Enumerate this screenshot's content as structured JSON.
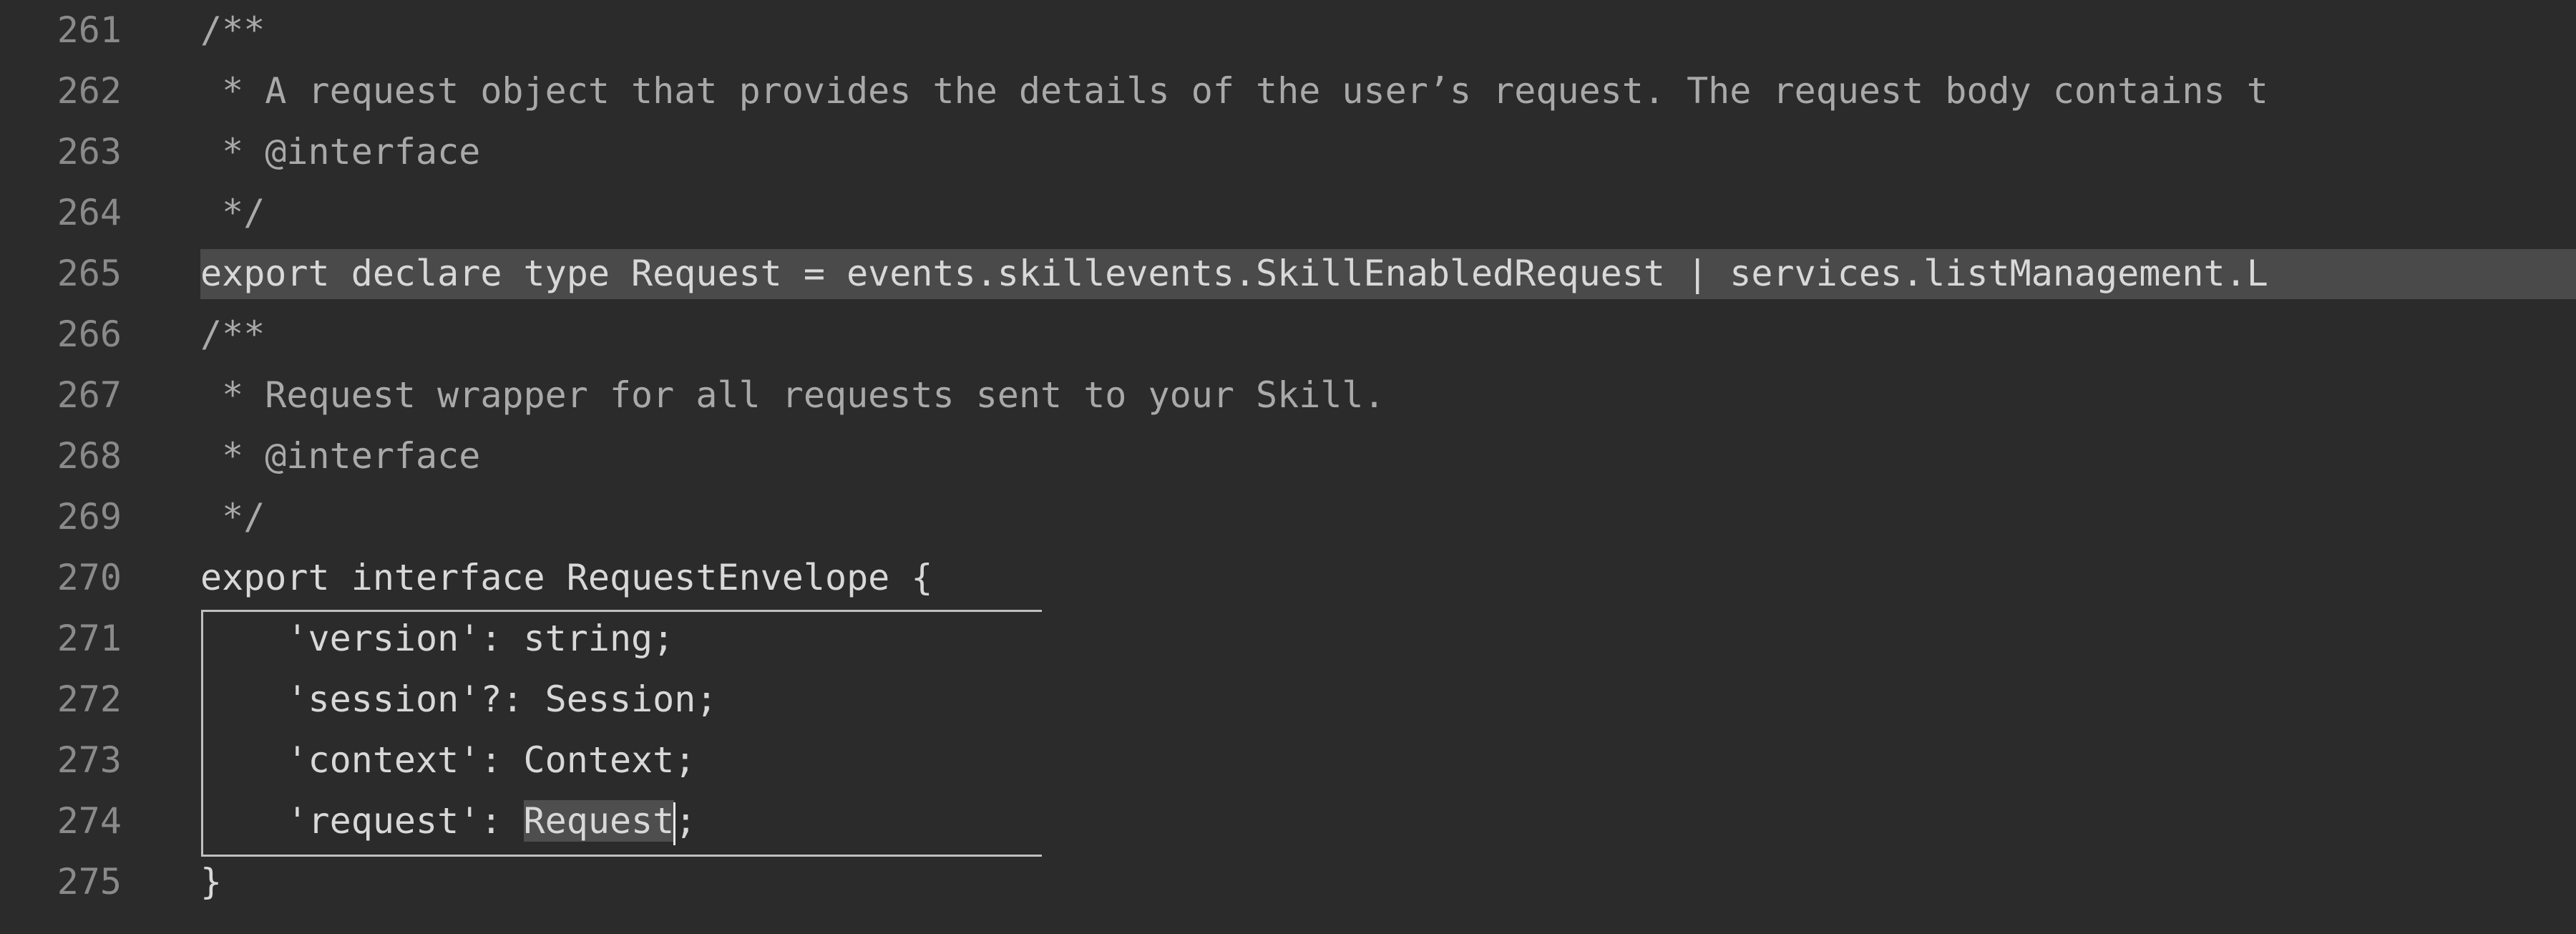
{
  "editor": {
    "lines": [
      {
        "num": "261",
        "text": "/**"
      },
      {
        "num": "262",
        "text": " * A request object that provides the details of the user’s request. The request body contains t"
      },
      {
        "num": "263",
        "text": " * @interface"
      },
      {
        "num": "264",
        "text": " */"
      },
      {
        "num": "265",
        "text": "export declare type Request = events.skillevents.SkillEnabledRequest | services.listManagement.L"
      },
      {
        "num": "266",
        "text": "/**"
      },
      {
        "num": "267",
        "text": " * Request wrapper for all requests sent to your Skill."
      },
      {
        "num": "268",
        "text": " * @interface"
      },
      {
        "num": "269",
        "text": " */"
      },
      {
        "num": "270",
        "text": "export interface RequestEnvelope {"
      },
      {
        "num": "271",
        "text": "    'version': string;"
      },
      {
        "num": "272",
        "text": "    'session'?: Session;"
      },
      {
        "num": "273",
        "text": "    'context': Context;"
      },
      {
        "num": "274",
        "text": "    'request': Request;"
      },
      {
        "num": "275",
        "text": "}"
      }
    ],
    "selected_word": "Request"
  }
}
